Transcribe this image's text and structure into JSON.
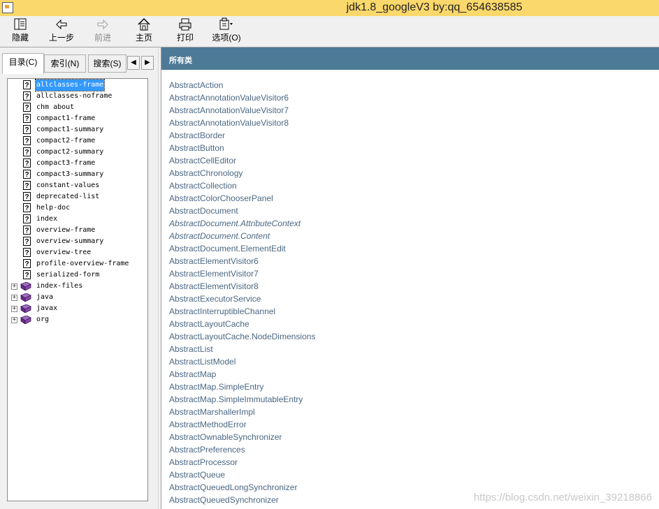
{
  "window": {
    "title": "jdk1.8_googleV3 by:qq_654638585"
  },
  "toolbar": {
    "hide": "隐藏",
    "back": "上一步",
    "forward": "前进",
    "home": "主页",
    "print": "打印",
    "options": "选项(O)"
  },
  "tabs": {
    "contents": "目录(C)",
    "index": "索引(N)",
    "search": "搜索(S)"
  },
  "tree": {
    "items": [
      "allclasses-frame",
      "allclasses-noframe",
      "chm about",
      "compact1-frame",
      "compact1-summary",
      "compact2-frame",
      "compact2-summary",
      "compact3-frame",
      "compact3-summary",
      "constant-values",
      "deprecated-list",
      "help-doc",
      "index",
      "overview-frame",
      "overview-summary",
      "overview-tree",
      "profile-overview-frame",
      "serialized-form"
    ],
    "folders": [
      "index-files",
      "java",
      "javax",
      "org"
    ]
  },
  "content": {
    "header": "所有类",
    "classes": [
      "AbstractAction",
      "AbstractAnnotationValueVisitor6",
      "AbstractAnnotationValueVisitor7",
      "AbstractAnnotationValueVisitor8",
      "AbstractBorder",
      "AbstractButton",
      "AbstractCellEditor",
      "AbstractChronology",
      "AbstractCollection",
      "AbstractColorChooserPanel",
      "AbstractDocument",
      "AbstractDocument.AttributeContext",
      "AbstractDocument.Content",
      "AbstractDocument.ElementEdit",
      "AbstractElementVisitor6",
      "AbstractElementVisitor7",
      "AbstractElementVisitor8",
      "AbstractExecutorService",
      "AbstractInterruptibleChannel",
      "AbstractLayoutCache",
      "AbstractLayoutCache.NodeDimensions",
      "AbstractList",
      "AbstractListModel",
      "AbstractMap",
      "AbstractMap.SimpleEntry",
      "AbstractMap.SimpleImmutableEntry",
      "AbstractMarshallerImpl",
      "AbstractMethodError",
      "AbstractOwnableSynchronizer",
      "AbstractPreferences",
      "AbstractProcessor",
      "AbstractQueue",
      "AbstractQueuedLongSynchronizer",
      "AbstractQueuedSynchronizer"
    ],
    "watermark": "https://blog.csdn.net/weixin_39218866"
  },
  "colors": {
    "titlebar": "#fbd86b",
    "header": "#4d7a97",
    "link": "#4a6782",
    "selection": "#3399ff"
  }
}
